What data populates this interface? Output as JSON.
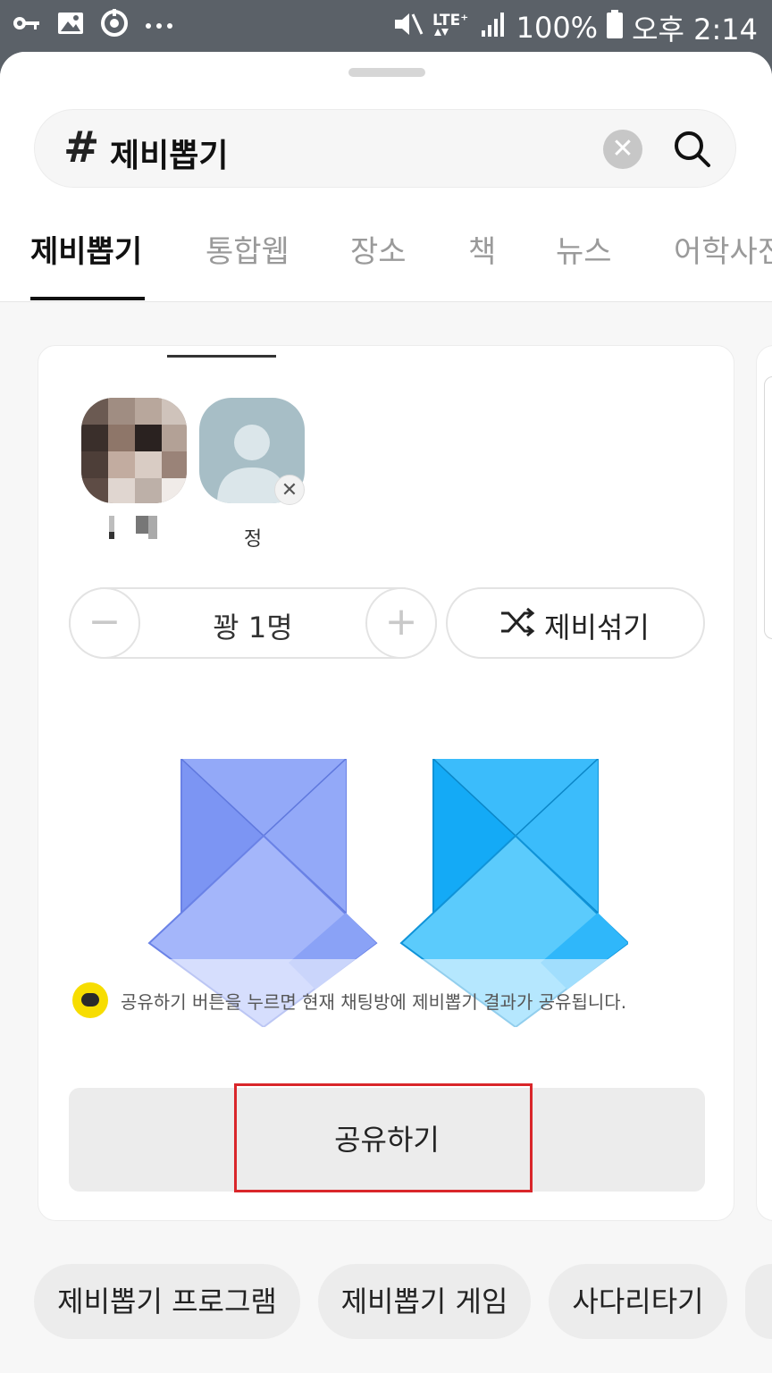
{
  "status_bar": {
    "battery": "100%",
    "time": "오후 2:14",
    "network": "LTE",
    "left_icons": [
      "key-icon",
      "image-icon",
      "sync-icon",
      "more-icon"
    ],
    "right_icons": [
      "mute-icon",
      "lte-icon",
      "signal-icon",
      "battery-icon"
    ]
  },
  "search": {
    "hash": "#",
    "query": "제비뽑기",
    "clear_symbol": "✕"
  },
  "tabs": [
    {
      "label": "제비뽑기",
      "active": true
    },
    {
      "label": "통합웹",
      "active": false
    },
    {
      "label": "장소",
      "active": false
    },
    {
      "label": "책",
      "active": false
    },
    {
      "label": "뉴스",
      "active": false
    },
    {
      "label": "어학사전",
      "active": false
    }
  ],
  "participants": [
    {
      "name": "",
      "avatar": "blurred-photo"
    },
    {
      "name": "정",
      "avatar": "default-person",
      "removable": true
    }
  ],
  "controls": {
    "minus": "−",
    "plus": "+",
    "winner_count": "꽝 1명",
    "shuffle_label": "제비섞기"
  },
  "envelopes": {
    "count": 2,
    "colors": [
      "#7f9cf5",
      "#18adf7"
    ]
  },
  "share_note": "공유하기 버튼을 누르면 현재 채팅방에 제비뽑기 결과가 공유됩니다.",
  "share_button": "공유하기",
  "related_chips": [
    "제비뽑기 프로그램",
    "제비뽑기 게임",
    "사다리타기"
  ],
  "colors": {
    "highlight": "#d9262a",
    "kakao_yellow": "#f7dd00",
    "status_bar": "#5b6168"
  }
}
